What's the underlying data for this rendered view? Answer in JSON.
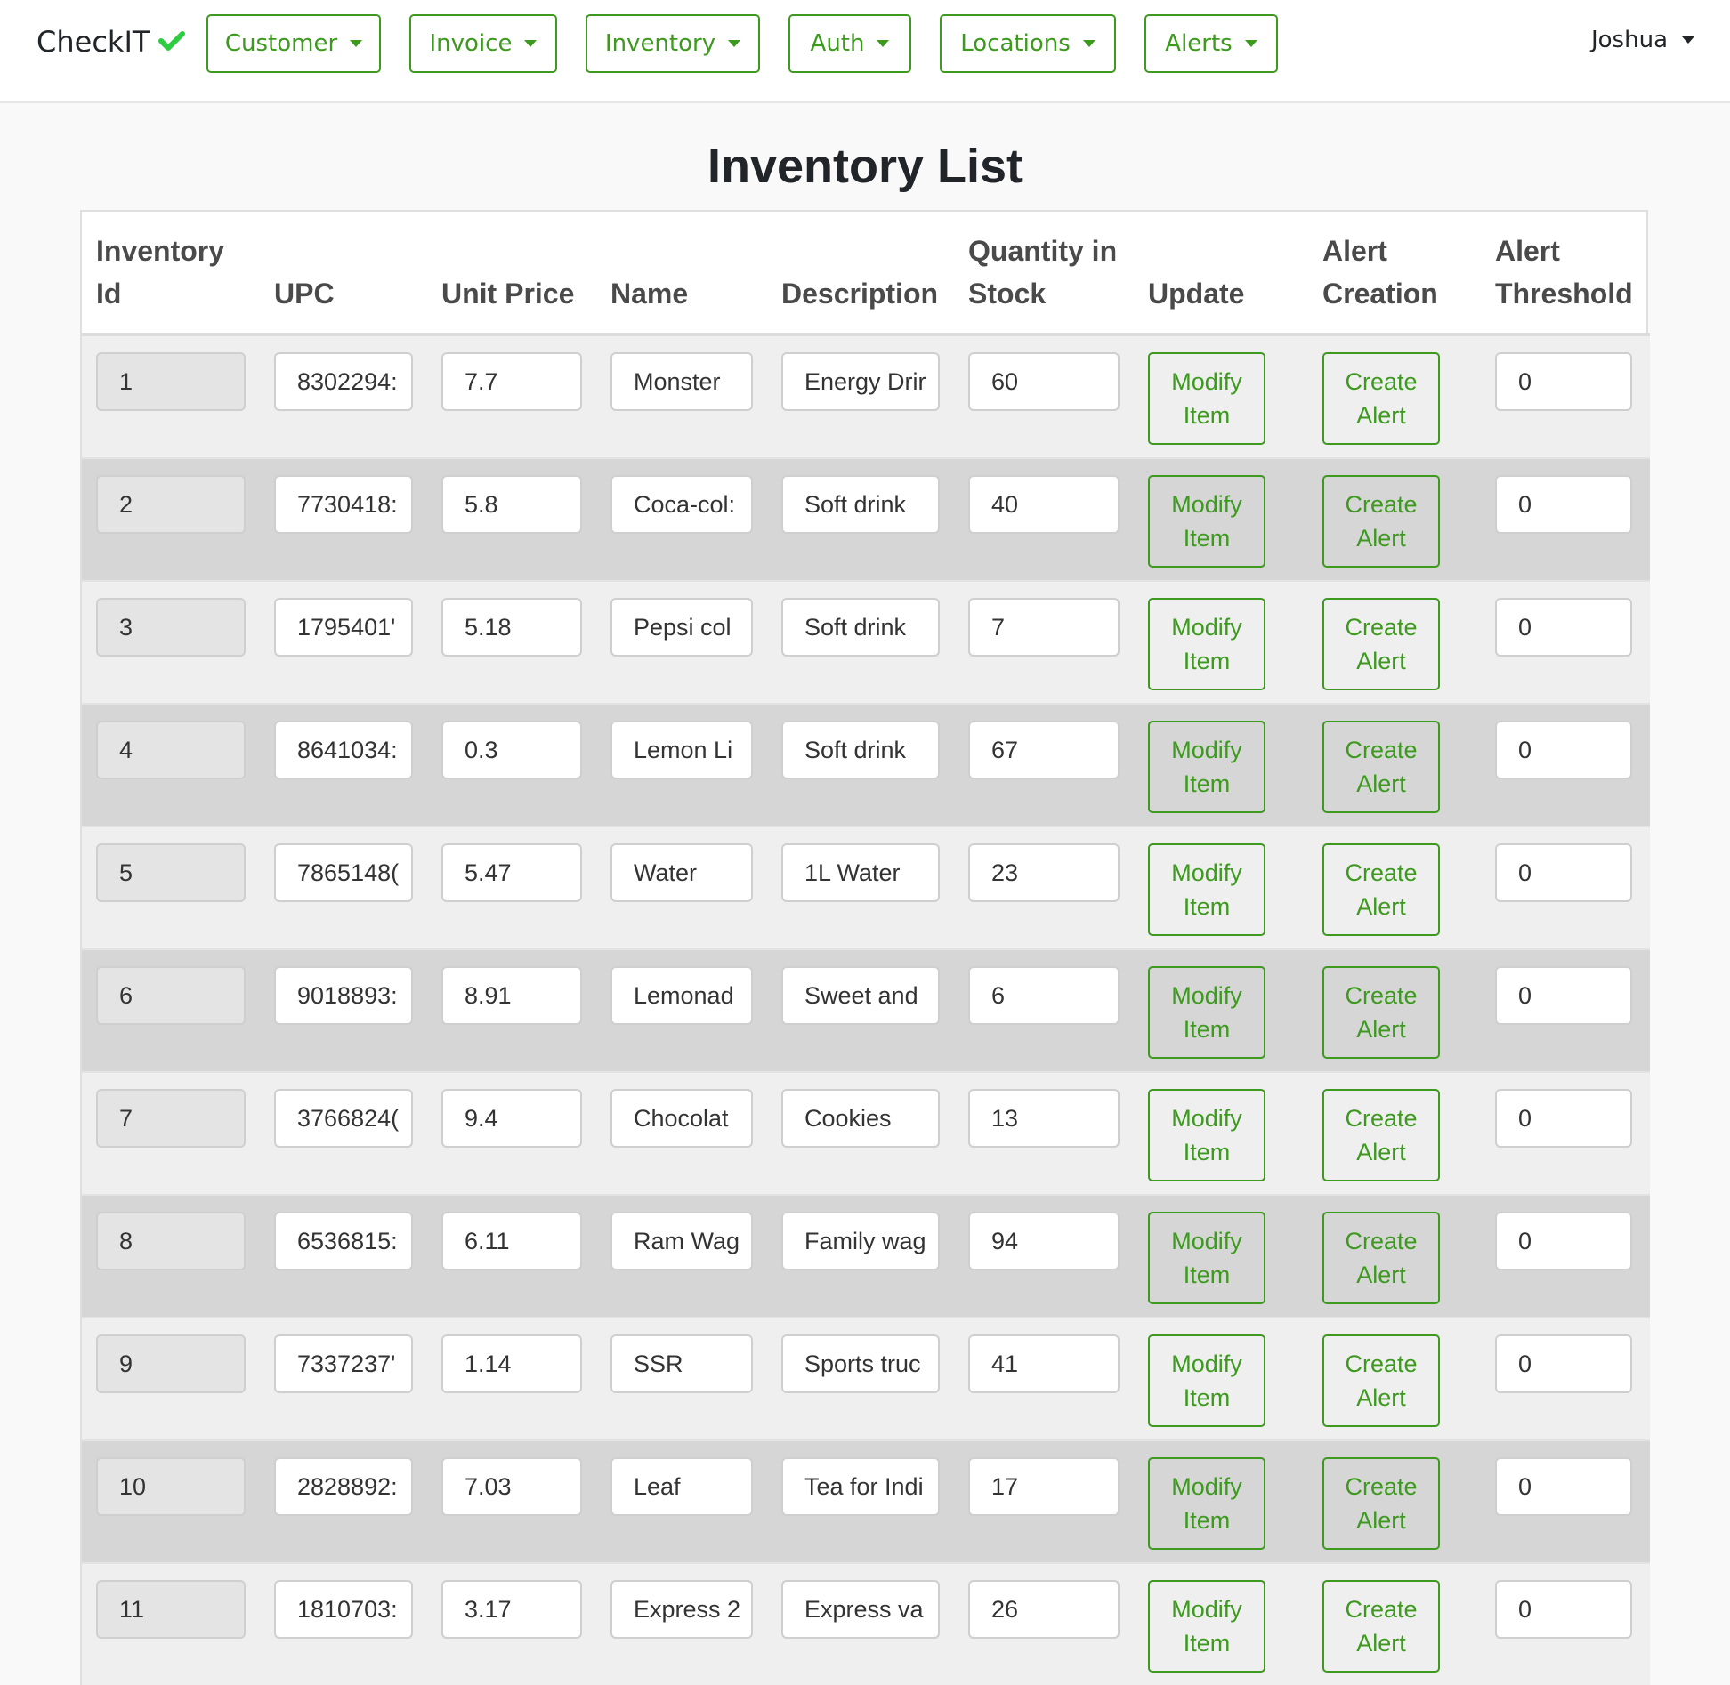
{
  "brand": {
    "name": "CheckIT"
  },
  "nav": {
    "menus": [
      "Customer",
      "Invoice",
      "Inventory",
      "Auth",
      "Locations",
      "Alerts"
    ],
    "user": "Joshua"
  },
  "colors": {
    "accent": "#3d9a1f",
    "check": "#2ecc40"
  },
  "page": {
    "title": "Inventory List"
  },
  "table": {
    "headers": [
      "Inventory Id",
      "UPC",
      "Unit Price",
      "Name",
      "Description",
      "Quantity in Stock",
      "Update",
      "Alert Creation",
      "Alert Threshold"
    ],
    "rows": [
      {
        "id": "1",
        "upc": "8302294:",
        "price": "7.7",
        "name": "Monster",
        "desc": "Energy Drir",
        "qty": "60",
        "update1": "Modify",
        "update2": "Item",
        "alert1": "Create",
        "alert2": "Alert",
        "threshold": "0"
      },
      {
        "id": "2",
        "upc": "7730418:",
        "price": "5.8",
        "name": "Coca-col:",
        "desc": "Soft drink",
        "qty": "40",
        "update1": "Modify",
        "update2": "Item",
        "alert1": "Create",
        "alert2": "Alert",
        "threshold": "0"
      },
      {
        "id": "3",
        "upc": "1795401'",
        "price": "5.18",
        "name": "Pepsi col",
        "desc": "Soft drink",
        "qty": "7",
        "update1": "Modify",
        "update2": "Item",
        "alert1": "Create",
        "alert2": "Alert",
        "threshold": "0"
      },
      {
        "id": "4",
        "upc": "8641034:",
        "price": "0.3",
        "name": "Lemon Li",
        "desc": "Soft drink",
        "qty": "67",
        "update1": "Modify",
        "update2": "Item",
        "alert1": "Create",
        "alert2": "Alert",
        "threshold": "0"
      },
      {
        "id": "5",
        "upc": "7865148(",
        "price": "5.47",
        "name": "Water",
        "desc": "1L Water",
        "qty": "23",
        "update1": "Modify",
        "update2": "Item",
        "alert1": "Create",
        "alert2": "Alert",
        "threshold": "0"
      },
      {
        "id": "6",
        "upc": "9018893:",
        "price": "8.91",
        "name": "Lemonad",
        "desc": "Sweet and",
        "qty": "6",
        "update1": "Modify",
        "update2": "Item",
        "alert1": "Create",
        "alert2": "Alert",
        "threshold": "0"
      },
      {
        "id": "7",
        "upc": "3766824(",
        "price": "9.4",
        "name": "Chocolat",
        "desc": "Cookies",
        "qty": "13",
        "update1": "Modify",
        "update2": "Item",
        "alert1": "Create",
        "alert2": "Alert",
        "threshold": "0"
      },
      {
        "id": "8",
        "upc": "6536815:",
        "price": "6.11",
        "name": "Ram Wag",
        "desc": "Family wag",
        "qty": "94",
        "update1": "Modify",
        "update2": "Item",
        "alert1": "Create",
        "alert2": "Alert",
        "threshold": "0"
      },
      {
        "id": "9",
        "upc": "7337237'",
        "price": "1.14",
        "name": "SSR",
        "desc": "Sports truc",
        "qty": "41",
        "update1": "Modify",
        "update2": "Item",
        "alert1": "Create",
        "alert2": "Alert",
        "threshold": "0"
      },
      {
        "id": "10",
        "upc": "2828892:",
        "price": "7.03",
        "name": "Leaf",
        "desc": "Tea for Indi",
        "qty": "17",
        "update1": "Modify",
        "update2": "Item",
        "alert1": "Create",
        "alert2": "Alert",
        "threshold": "0"
      },
      {
        "id": "11",
        "upc": "1810703:",
        "price": "3.17",
        "name": "Express 2",
        "desc": "Express va",
        "qty": "26",
        "update1": "Modify",
        "update2": "Item",
        "alert1": "Create",
        "alert2": "Alert",
        "threshold": "0"
      }
    ]
  }
}
